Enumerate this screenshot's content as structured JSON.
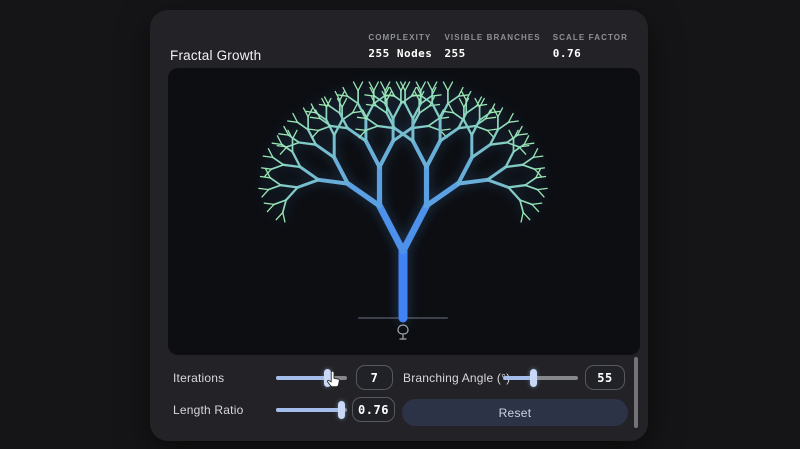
{
  "header": {
    "title": "Fractal Growth",
    "stats": [
      {
        "label": "COMPLEXITY",
        "value": "255 Nodes"
      },
      {
        "label": "VISIBLE BRANCHES",
        "value": "255"
      },
      {
        "label": "SCALE FACTOR",
        "value": "0.76"
      }
    ]
  },
  "controls": {
    "iterations": {
      "label": "Iterations",
      "value": "7",
      "fill_pct": 72
    },
    "branching_angle": {
      "label": "Branching Angle (°)",
      "value": "55",
      "fill_pct": 40
    },
    "length_ratio": {
      "label": "Length Ratio",
      "value": "0.76",
      "fill_pct": 91
    },
    "reset_label": "Reset"
  },
  "fractal": {
    "iterations": 7,
    "branching_angle_deg": 55,
    "length_ratio": 0.76
  },
  "colors": {
    "trunk_blue": "#4183f4",
    "tip_green": "#9ce8b4",
    "accent_slider": "#a4bdea",
    "card_bg": "#232327",
    "canvas_bg": "#0c0e12"
  }
}
